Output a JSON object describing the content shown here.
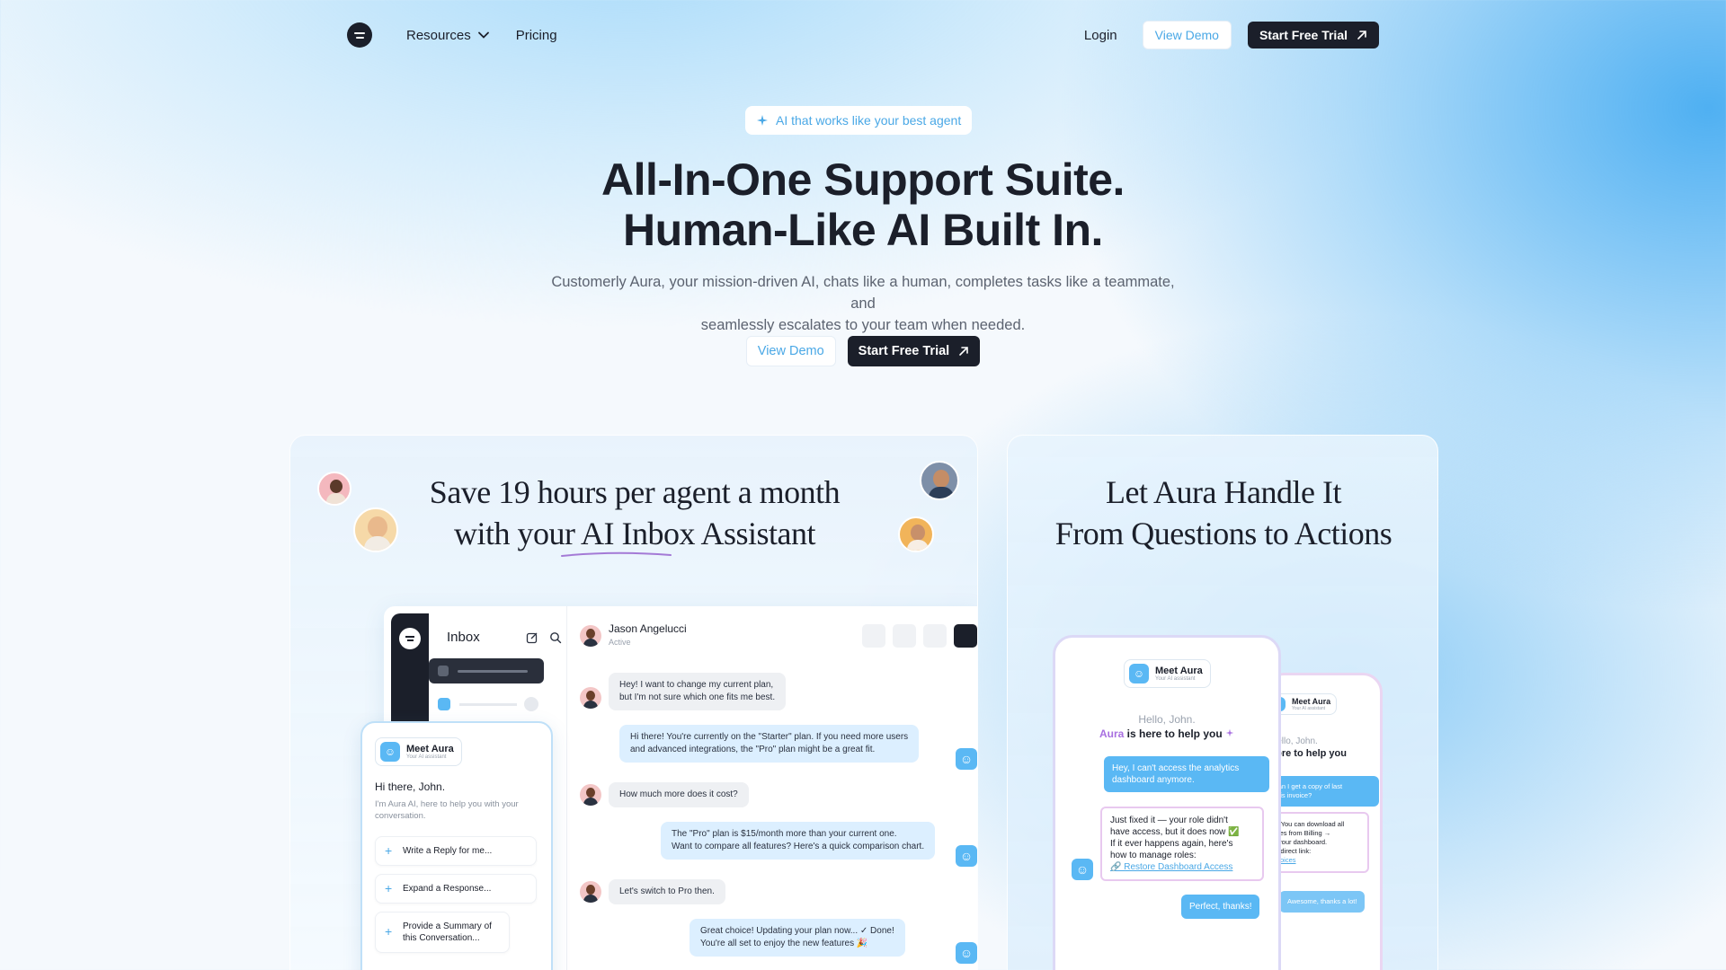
{
  "nav": {
    "resources": "Resources",
    "pricing": "Pricing",
    "login": "Login",
    "view_demo": "View Demo",
    "start_trial": "Start Free Trial"
  },
  "hero": {
    "badge": "AI that works like your best agent",
    "title_line1": "All-In-One Support Suite.",
    "title_line2": "Human-Like AI Built In.",
    "subtitle_line1": "Customerly Aura, your mission-driven AI, chats like a human, completes tasks like a teammate, and",
    "subtitle_line2": "seamlessly escalates to your team when needed.",
    "view_demo": "View Demo",
    "start_trial": "Start Free Trial"
  },
  "card_left": {
    "heading_line1": "Save 19 hours per agent a month",
    "heading_line2": "with your AI Inbox Assistant",
    "inbox": {
      "title": "Inbox",
      "contact_name": "Jason Angelucci",
      "contact_status": "Active",
      "messages": [
        {
          "line1": "Hey! I want to change my current plan,",
          "line2": "but I'm not sure which one fits me best."
        },
        {
          "line1": "Hi there! You're currently on the \"Starter\" plan. If you need more users",
          "line2": "and advanced integrations, the \"Pro\" plan might be a great fit."
        },
        {
          "line1": "How much more does it cost?",
          "line2": ""
        },
        {
          "line1": "The \"Pro\" plan is $15/month more than your current one.",
          "line2": "Want to compare all features? Here's a quick comparison chart."
        },
        {
          "line1": "Let's switch to Pro then.",
          "line2": ""
        },
        {
          "line1": "Great choice! Updating your plan now... ✓ Done!",
          "line2": "You're all set to enjoy the new features 🎉"
        }
      ]
    },
    "aura": {
      "meet": "Meet Aura",
      "meet_sub": "Your AI assistant",
      "greeting": "Hi there, John.",
      "intro_line1": "I'm Aura AI, here to help you with your",
      "intro_line2": "conversation.",
      "actions": [
        "Write a Reply for me...",
        "Expand a Response...",
        "Provide a Summary of this Conversation..."
      ]
    }
  },
  "card_right": {
    "heading_line1": "Let Aura Handle It",
    "heading_line2": "From Questions to Actions",
    "phone_main": {
      "meet": "Meet Aura",
      "meet_sub": "Your AI assistant",
      "hello": "Hello, John.",
      "aura": "Aura",
      "help": "is here to help you",
      "user_msg": "Hey, I can't access the analytics dashboard anymore.",
      "bot_line1": "Just fixed it — your role didn't",
      "bot_line2": "have access, but it does now ✅",
      "bot_line3": "If it ever happens again, here's",
      "bot_line4": "how to manage roles:",
      "bot_link": "🔗 Restore Dashboard Access",
      "user_reply": "Perfect, thanks!"
    },
    "phone_back": {
      "meet": "Meet Aura",
      "meet_sub": "Your AI assistant",
      "hello": "Hello, John.",
      "help": "here to help you",
      "user_msg_line1": "can I get a copy of last",
      "user_msg_line2": "this invoice?",
      "bot_line1": "re! You can download all",
      "bot_line2": "oices from Billing →",
      "bot_line3": "in your dashboard.",
      "bot_line4": "he direct link:",
      "bot_link": "Invoices",
      "user_reply": "Awesome, thanks a lot!"
    }
  },
  "colors": {
    "accent": "#4aa8e6",
    "dark": "#1b1f2a",
    "bubble_user": "#5ab8f4"
  }
}
